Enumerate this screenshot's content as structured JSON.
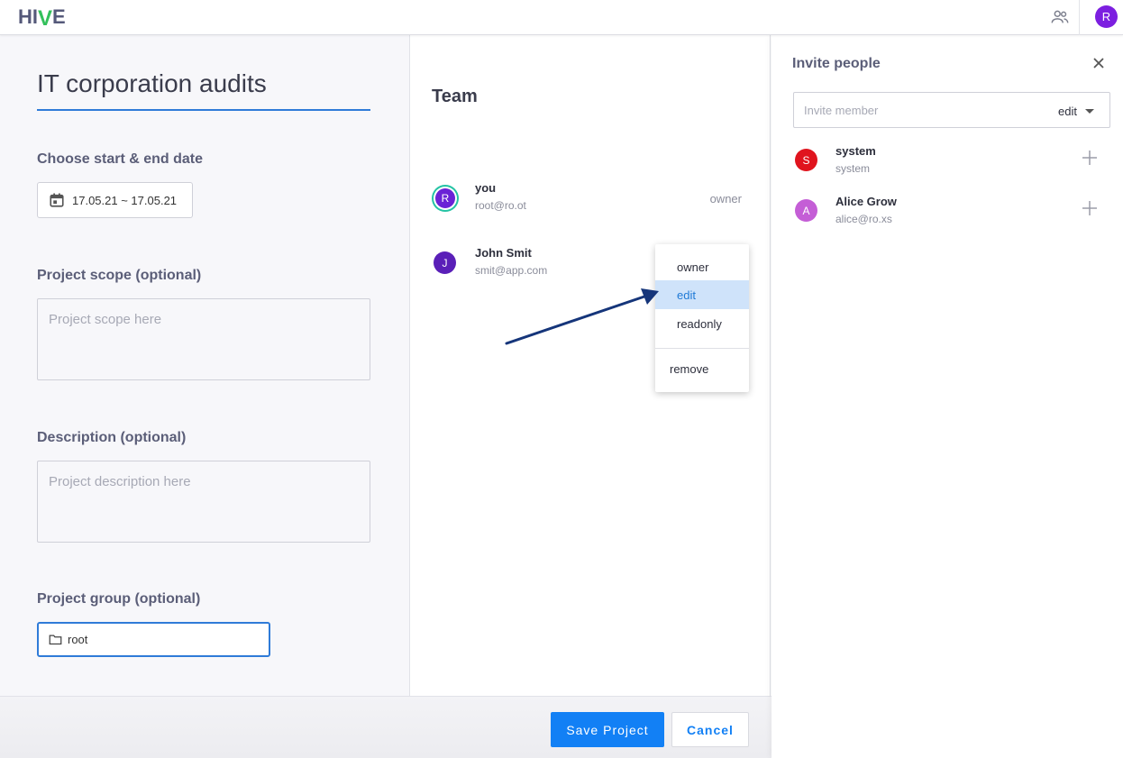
{
  "app": {
    "logo_text": "HIVE"
  },
  "header": {
    "user_initial": "R"
  },
  "project": {
    "title": "IT corporation audits",
    "date_label": "Choose start & end date",
    "date_range": "17.05.21 ~ 17.05.21",
    "scope_label": "Project scope (optional)",
    "scope_placeholder": "Project scope here",
    "description_label": "Description (optional)",
    "description_placeholder": "Project description here",
    "group_label": "Project group (optional)",
    "group_value": "root"
  },
  "team": {
    "title": "Team",
    "members": [
      {
        "initial": "R",
        "name": "you",
        "email": "root@ro.ot",
        "role": "owner"
      },
      {
        "initial": "J",
        "name": "John Smit",
        "email": "smit@app.com"
      }
    ]
  },
  "role_menu": {
    "items": [
      "owner",
      "edit",
      "readonly"
    ],
    "selected": "edit",
    "remove_label": "remove"
  },
  "actions": {
    "save_label": "Save Project",
    "cancel_label": "Cancel"
  },
  "invite": {
    "title": "Invite people",
    "placeholder": "Invite member",
    "permission": "edit",
    "candidates": [
      {
        "initial": "S",
        "name": "system",
        "email": "system",
        "color": "#e0141e"
      },
      {
        "initial": "A",
        "name": "Alice Grow",
        "email": "alice@ro.xs",
        "color": "#c45ed6"
      }
    ]
  },
  "colors": {
    "accent": "#1280f5",
    "focus": "#2f7bd8",
    "logo_green": "#33c05b",
    "arrow": "#15357a"
  }
}
